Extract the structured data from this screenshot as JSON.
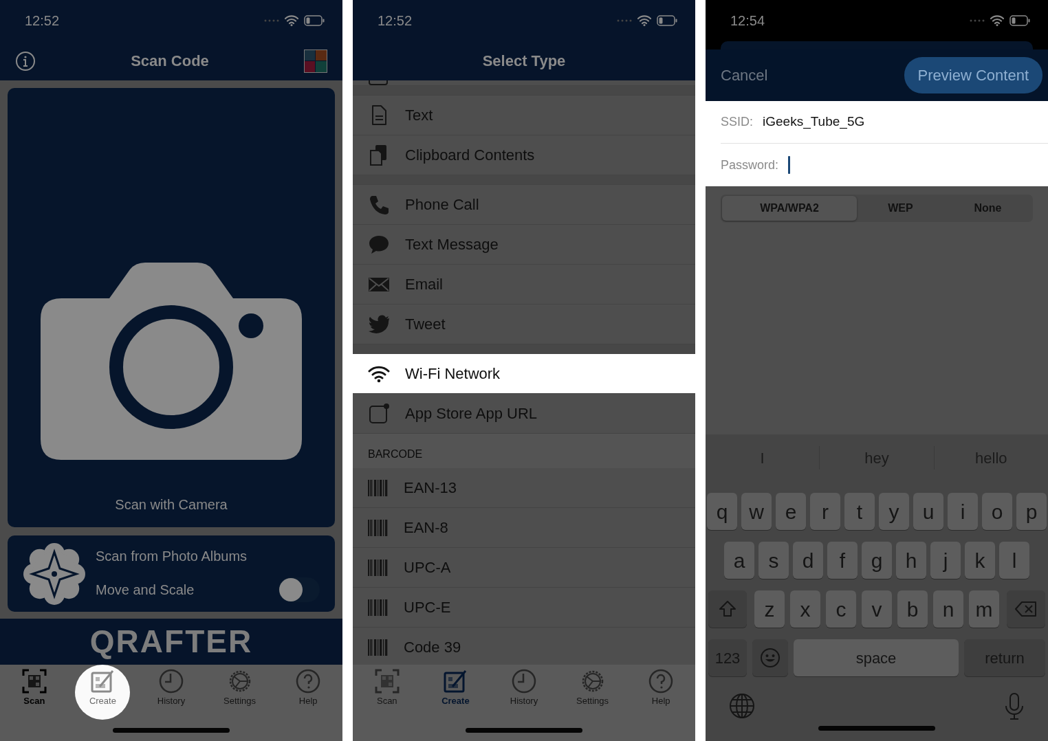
{
  "scan_screen": {
    "status_time": "12:52",
    "title": "Scan Code",
    "camera_caption": "Scan with Camera",
    "photo_card": {
      "title": "Scan from Photo Albums",
      "subtitle": "Move and Scale",
      "toggle_on": false
    },
    "logo": "QRAFTER",
    "tabs": [
      {
        "label": "Scan",
        "selected": true,
        "highlighted": false
      },
      {
        "label": "Create",
        "selected": false,
        "highlighted": true
      },
      {
        "label": "History",
        "selected": false,
        "highlighted": false
      },
      {
        "label": "Settings",
        "selected": false,
        "highlighted": false
      },
      {
        "label": "Help",
        "selected": false,
        "highlighted": false
      }
    ]
  },
  "select_type_screen": {
    "status_time": "12:52",
    "title": "Select Type",
    "sections": [
      {
        "items": [
          {
            "label": "Text",
            "selected": false
          },
          {
            "label": "Clipboard Contents",
            "selected": false
          }
        ]
      },
      {
        "items": [
          {
            "label": "Phone Call",
            "selected": false
          },
          {
            "label": "Text Message",
            "selected": false
          },
          {
            "label": "Email",
            "selected": false
          },
          {
            "label": "Tweet",
            "selected": false
          }
        ]
      },
      {
        "items": [
          {
            "label": "Wi-Fi Network",
            "selected": true
          },
          {
            "label": "App Store App URL",
            "selected": false
          }
        ]
      },
      {
        "header": "BARCODE",
        "items": [
          {
            "label": "EAN-13",
            "selected": false
          },
          {
            "label": "EAN-8",
            "selected": false
          },
          {
            "label": "UPC-A",
            "selected": false
          },
          {
            "label": "UPC-E",
            "selected": false
          },
          {
            "label": "Code 39",
            "selected": false
          }
        ]
      }
    ],
    "tabs": [
      {
        "label": "Scan",
        "selected": false
      },
      {
        "label": "Create",
        "selected": true
      },
      {
        "label": "History",
        "selected": false
      },
      {
        "label": "Settings",
        "selected": false
      },
      {
        "label": "Help",
        "selected": false
      }
    ]
  },
  "wifi_screen": {
    "status_time": "12:54",
    "cancel": "Cancel",
    "preview": "Preview Content",
    "fields": [
      {
        "label": "SSID:",
        "value": "iGeeks_Tube_5G",
        "focused": false
      },
      {
        "label": "Password:",
        "focused": true
      }
    ],
    "security": [
      {
        "label": "WPA/WPA2",
        "selected": true
      },
      {
        "label": "WEP",
        "selected": false
      },
      {
        "label": "None",
        "selected": false
      }
    ],
    "suggestions": [
      "I",
      "hey",
      "hello"
    ],
    "key_rows": [
      [
        "q",
        "w",
        "e",
        "r",
        "t",
        "y",
        "u",
        "i",
        "o",
        "p"
      ],
      [
        "a",
        "s",
        "d",
        "f",
        "g",
        "h",
        "j",
        "k",
        "l"
      ],
      [
        "z",
        "x",
        "c",
        "v",
        "b",
        "n",
        "m"
      ]
    ],
    "bottom_keys": {
      "numbers": "123",
      "space": "space",
      "return": "return"
    }
  }
}
